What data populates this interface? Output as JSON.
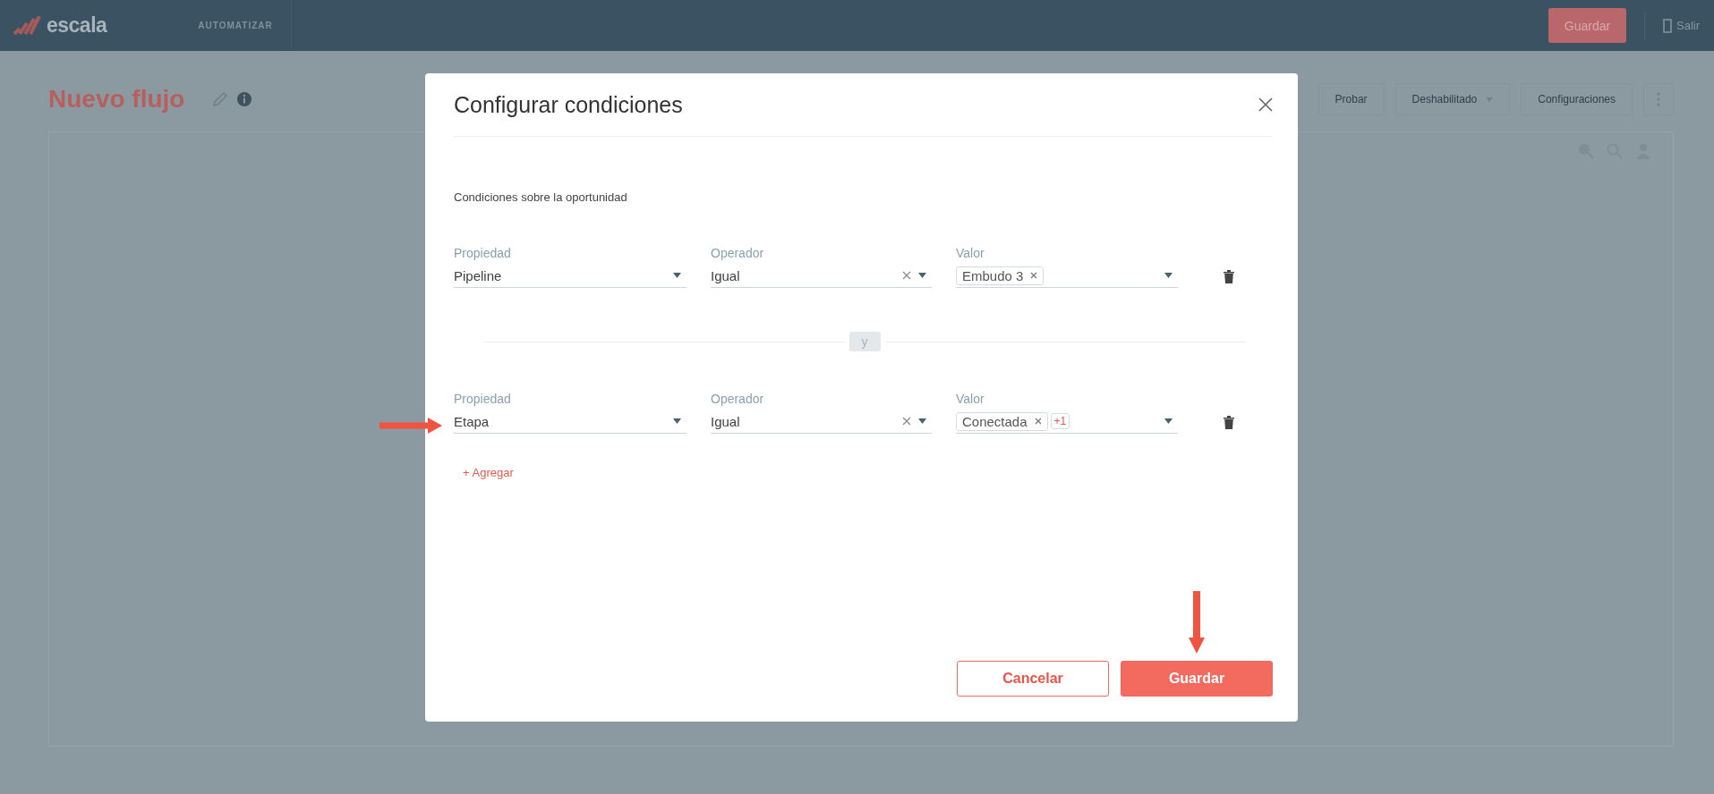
{
  "header": {
    "logo": "escala",
    "nav": "AUTOMATIZAR",
    "save_button": "Guardar",
    "exit_link": "Salir"
  },
  "page": {
    "title": "Nuevo flujo",
    "actions": [
      {
        "kind": "button",
        "label": "Probar"
      },
      {
        "kind": "dropdown",
        "label": "Deshabilitado"
      },
      {
        "kind": "button",
        "label": "Configuraciones"
      },
      {
        "kind": "more"
      }
    ]
  },
  "dialog": {
    "title": "Configurar condiciones",
    "subtitle": "Condiciones sobre la oportunidad",
    "conditions": [
      {
        "property_label": "Propiedad",
        "property": "Pipeline",
        "operator_label": "Operador",
        "operator": "Igual",
        "value_label": "Valor",
        "values": [
          "Embudo 3"
        ],
        "highlighted": false
      },
      {
        "property_label": "Propiedad",
        "property": "Etapa",
        "operator_label": "Operador",
        "operator": "Igual",
        "value_label": "Valor",
        "values": [
          "Conectada"
        ],
        "more": "+1",
        "highlighted": true
      }
    ],
    "joiner": "y",
    "add_link": "+ Agregar",
    "cancel_button": "Cancelar",
    "save_button": "Guardar",
    "save_highlighted": true
  }
}
